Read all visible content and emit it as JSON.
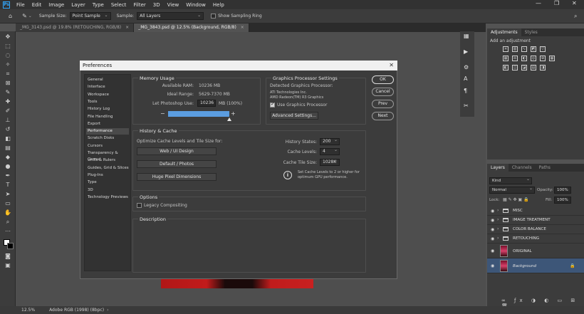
{
  "app": {
    "logo": "Ps",
    "menu": [
      "File",
      "Edit",
      "Image",
      "Layer",
      "Type",
      "Select",
      "Filter",
      "3D",
      "View",
      "Window",
      "Help"
    ]
  },
  "options_bar": {
    "sample_size_label": "Sample Size:",
    "sample_size_value": "Point Sample",
    "sample_label": "Sample:",
    "sample_value": "All Layers",
    "sampling_ring_label": "Show Sampling Ring"
  },
  "doc_tabs": [
    {
      "label": "_MG_3143.psd @ 19.8% (RETOUCHING, RGB/8)",
      "active": false
    },
    {
      "label": "_MG_3843.psd @ 12.5% (Background, RGB/8)",
      "active": true
    }
  ],
  "status": {
    "zoom": "12.5%",
    "profile": "Adobe RGB (1998) (8bpc)"
  },
  "right_panel": {
    "adjust_tabs": [
      "Adjustments",
      "Styles"
    ],
    "adjust_hint": "Add an adjustment",
    "layer_tabs": [
      "Layers",
      "Channels",
      "Paths"
    ],
    "kind_label": "Kind",
    "blend_mode": "Normal",
    "opacity_label": "Opacity:",
    "opacity_value": "100%",
    "lock_label": "Lock:",
    "fill_label": "Fill:",
    "fill_value": "100%",
    "layers": [
      {
        "name": "MISC",
        "type": "group"
      },
      {
        "name": "IMAGE TREATMENT",
        "type": "group"
      },
      {
        "name": "COLOR BALANCE",
        "type": "group"
      },
      {
        "name": "RETOUCHING",
        "type": "group"
      },
      {
        "name": "ORIGINAL",
        "type": "pixel"
      },
      {
        "name": "Background",
        "type": "pixel",
        "selected": true,
        "locked": true
      }
    ]
  },
  "dialog": {
    "title": "Preferences",
    "nav": [
      "General",
      "Interface",
      "Workspace",
      "Tools",
      "History Log",
      "File Handling",
      "Export",
      "Performance",
      "Scratch Disks",
      "Cursors",
      "Transparency & Gamut",
      "Units & Rulers",
      "Guides, Grid & Slices",
      "Plug-Ins",
      "Type",
      "3D",
      "Technology Previews"
    ],
    "nav_active": "Performance",
    "memory": {
      "title": "Memory Usage",
      "available_label": "Available RAM:",
      "available_value": "10236 MB",
      "ideal_label": "Ideal Range:",
      "ideal_value": "5629-7370 MB",
      "let_label": "Let Photoshop Use:",
      "let_value": "10236",
      "let_unit": "MB (100%)",
      "minus": "−",
      "plus": "+",
      "slider_fraction": 1.0
    },
    "gpu": {
      "title": "Graphics Processor Settings",
      "detected_label": "Detected Graphics Processor:",
      "vendor": "ATI Technologies Inc.",
      "model": "AMD Radeon(TM) R3 Graphics",
      "use_label": "Use Graphics Processor",
      "use_checked": true,
      "advanced_button": "Advanced Settings..."
    },
    "history": {
      "title": "History & Cache",
      "optimize_label": "Optimize Cache Levels and Tile Size for:",
      "buttons": [
        "Web / UI Design",
        "Default / Photos",
        "Huge Pixel Dimensions"
      ],
      "states_label": "History States:",
      "states_value": "200",
      "levels_label": "Cache Levels:",
      "levels_value": "4",
      "tile_label": "Cache Tile Size:",
      "tile_value": "1028K",
      "info_line1": "Set Cache Levels to 2 or higher for",
      "info_line2": "optimum GPU performance."
    },
    "options": {
      "title": "Options",
      "legacy_label": "Legacy Compositing",
      "legacy_checked": false
    },
    "description": {
      "title": "Description"
    },
    "buttons": {
      "ok": "OK",
      "cancel": "Cancel",
      "prev": "Prev",
      "next": "Next"
    }
  }
}
